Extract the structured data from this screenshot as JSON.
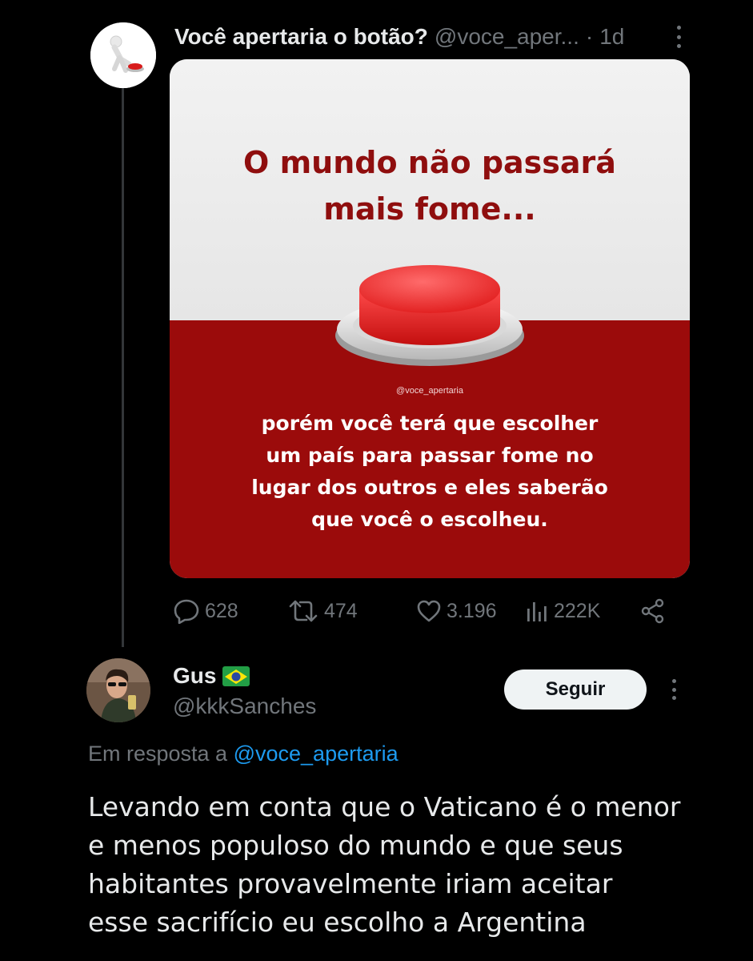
{
  "quoted_tweet": {
    "author_name": "Você apertaria o botão?",
    "author_handle": "@voce_aper...",
    "separator": "·",
    "time": "1d",
    "image": {
      "title_line1": "O mundo não passará",
      "title_line2": "mais fome...",
      "watermark": "@voce_apertaria",
      "body_line1": "porém você terá que escolher",
      "body_line2": "um país para passar fome no",
      "body_line3": "lugar dos outros e eles saberão",
      "body_line4": "que você o escolheu."
    },
    "stats": {
      "replies": "628",
      "retweets": "474",
      "likes": "3.196",
      "views": "222K"
    }
  },
  "reply": {
    "author_name": "Gus",
    "author_handle": "@kkkSanches",
    "follow_label": "Seguir",
    "in_reply_prefix": "Em resposta a",
    "in_reply_mention": "@voce_apertaria",
    "text_line1": "Levando em conta que o Vaticano é o menor",
    "text_line2": "e menos populoso do mundo e que seus",
    "text_line3": "habitantes provavelmente iriam aceitar",
    "text_line4": "esse sacrifício eu escolho a Argentina"
  },
  "colors": {
    "background": "#000000",
    "text_primary": "#e7e9ea",
    "text_secondary": "#71767b",
    "link": "#1d9bf0",
    "card_red": "#9b0b0b",
    "button_red": "#e32020"
  }
}
